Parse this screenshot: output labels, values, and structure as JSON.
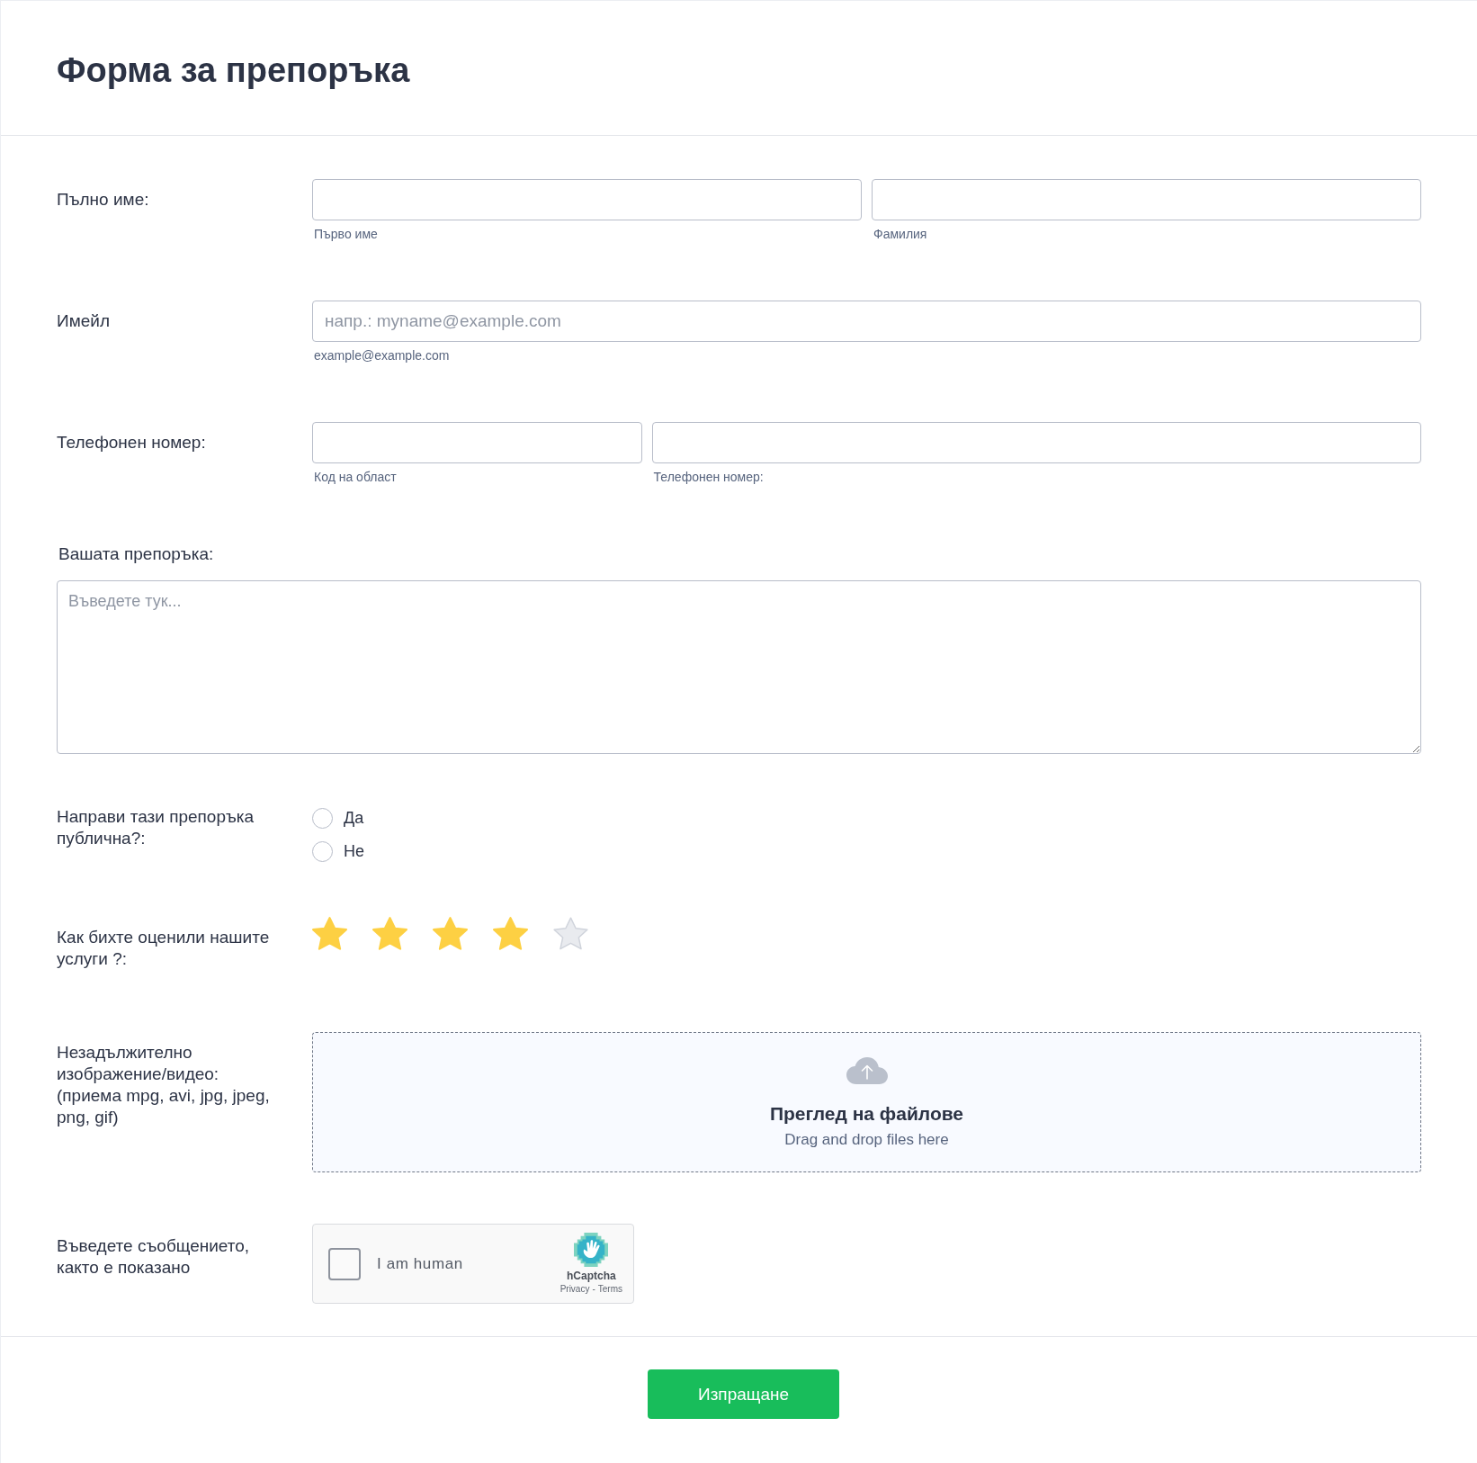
{
  "header": {
    "title": "Форма за препоръка"
  },
  "fields": [
    {
      "kind": "name",
      "label": "Пълно име:",
      "inputs": [
        {
          "sublabel": "Първо име"
        },
        {
          "sublabel": "Фамилия"
        }
      ]
    },
    {
      "kind": "email",
      "label": "Имейл",
      "inputs": [
        {
          "placeholder": "напр.: myname@example.com",
          "sublabel": "example@example.com"
        }
      ]
    },
    {
      "kind": "phone",
      "label": "Телефонен номер:",
      "inputs": [
        {
          "sublabel": "Код на област"
        },
        {
          "sublabel": "Телефонен номер:"
        }
      ]
    },
    {
      "kind": "textarea",
      "label": "Вашата препоръка:",
      "placeholder": "Въведете тук..."
    },
    {
      "kind": "radio",
      "label": "Направи тази препоръка публична?:",
      "options": [
        {
          "label": "Да",
          "selected": false
        },
        {
          "label": "Не",
          "selected": false
        }
      ]
    },
    {
      "kind": "rating",
      "label": "Как бихте оценили нашите услуги ?:",
      "stars": 4
    },
    {
      "kind": "upload",
      "label": "Незадължително изображение/видео: (приема mpg, avi, jpg, jpeg, png, gif)",
      "title": "Преглед на файлове",
      "hint": "Drag and drop files here"
    },
    {
      "kind": "captcha",
      "label": "Въведете съобщението, както е показано",
      "checkbox_label": "I am human",
      "checked": false,
      "brand": "hCaptcha",
      "links": [
        {
          "label": "Privacy"
        },
        {
          "label": "Terms"
        }
      ],
      "separator": "-"
    }
  ],
  "submit": {
    "label": "Изпращане"
  }
}
